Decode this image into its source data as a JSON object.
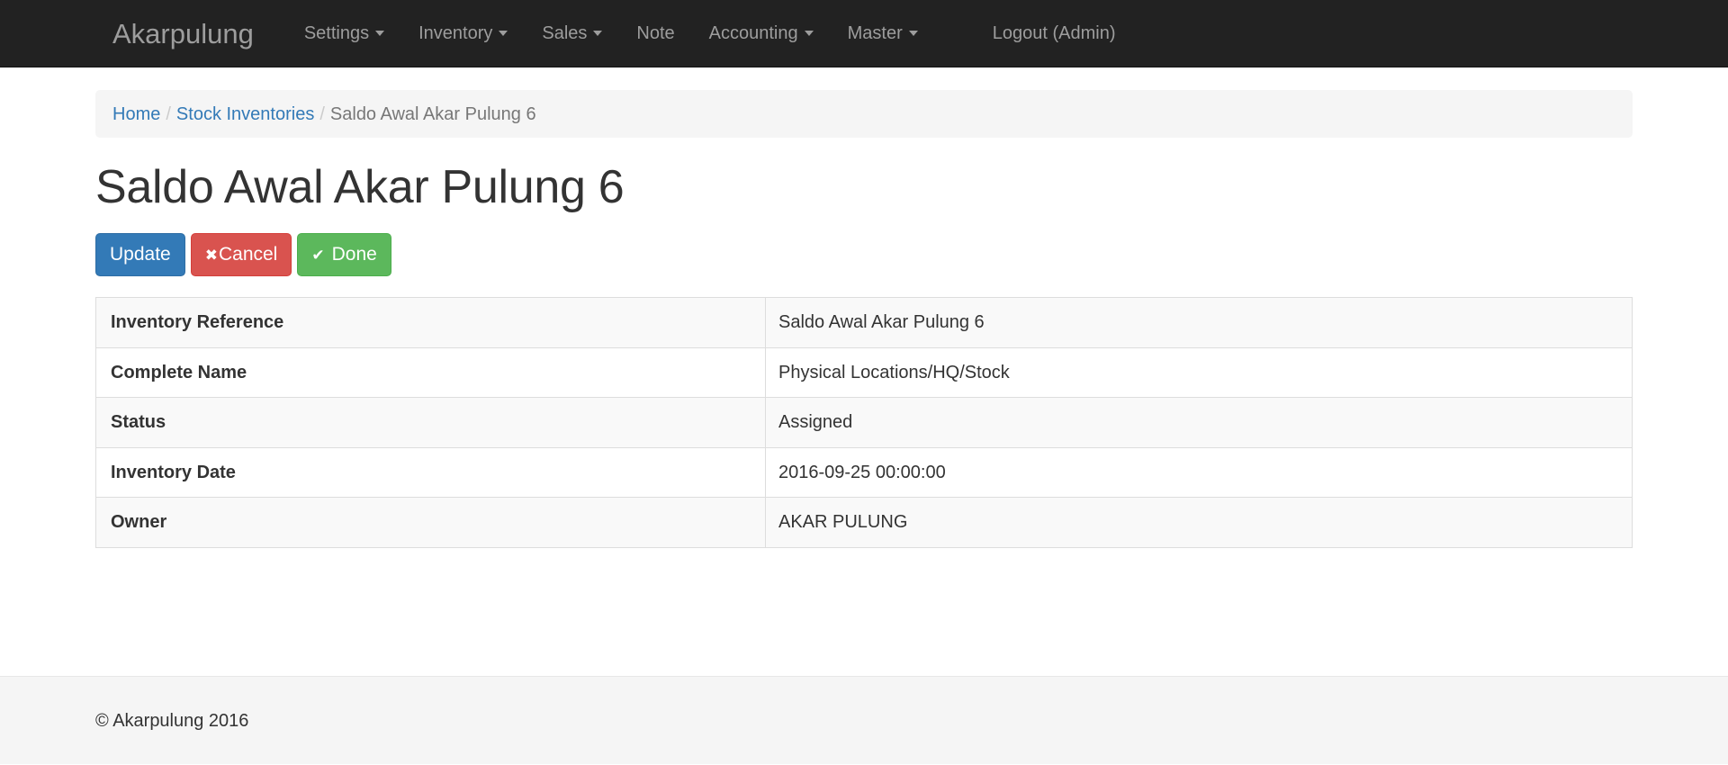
{
  "navbar": {
    "brand": "Akarpulung",
    "items": [
      {
        "label": "Settings",
        "caret": true
      },
      {
        "label": "Inventory",
        "caret": true
      },
      {
        "label": "Sales",
        "caret": true
      },
      {
        "label": "Note",
        "caret": false
      },
      {
        "label": "Accounting",
        "caret": true
      },
      {
        "label": "Master",
        "caret": true
      }
    ],
    "logout_label": "Logout (Admin)",
    "background_color": "#222222",
    "link_color": "#9d9d9d"
  },
  "breadcrumb": {
    "home": "Home",
    "parent": "Stock Inventories",
    "current": "Saldo Awal Akar Pulung 6",
    "separator": "/"
  },
  "page": {
    "title": "Saldo Awal Akar Pulung 6"
  },
  "actions": {
    "update_label": "Update",
    "cancel_label": "Cancel",
    "cancel_icon": "times-icon",
    "done_label": "Done",
    "done_icon": "check-icon",
    "update_color": "#337ab7",
    "cancel_color": "#d9534f",
    "done_color": "#5cb85c"
  },
  "detail_table": {
    "rows": [
      {
        "label": "Inventory Reference",
        "value": "Saldo Awal Akar Pulung 6"
      },
      {
        "label": "Complete Name",
        "value": "Physical Locations/HQ/Stock"
      },
      {
        "label": "Status",
        "value": "Assigned"
      },
      {
        "label": "Inventory Date",
        "value": "2016-09-25 00:00:00"
      },
      {
        "label": "Owner",
        "value": "AKAR PULUNG"
      }
    ]
  },
  "footer": {
    "copyright": "© Akarpulung 2016"
  }
}
